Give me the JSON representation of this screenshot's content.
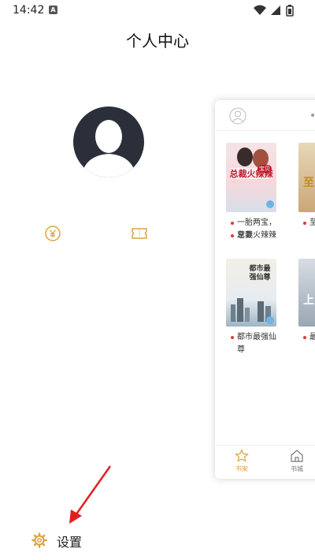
{
  "status_bar": {
    "time": "14:42",
    "notif_glyph": "A"
  },
  "header": {
    "title": "个人中心"
  },
  "profile": {
    "avatar": "default-avatar"
  },
  "quick_icons": [
    "coin-icon",
    "ticket-icon"
  ],
  "preview": {
    "books": [
      {
        "title_lines": [
          "一胎两宝，总裁",
          "宠妻火辣辣"
        ],
        "cover_text": "总裁火辣辣",
        "badge": "宝贝"
      },
      {
        "title_lines": [
          "至尊"
        ],
        "cover_text": "至"
      },
      {
        "title_lines": [
          "都市最强仙尊"
        ],
        "cover_text": "都市最强仙尊"
      },
      {
        "title_lines": [
          "最强"
        ],
        "cover_text": "上"
      }
    ],
    "tabs": [
      {
        "label": "书架",
        "icon": "bookshelf-icon",
        "active": true
      },
      {
        "label": "书城",
        "icon": "store-icon",
        "active": false
      }
    ]
  },
  "settings": {
    "label": "设置"
  },
  "colors": {
    "accent": "#d9a441",
    "red": "#e03a3a",
    "avatar_bg": "#2b2f3a"
  }
}
